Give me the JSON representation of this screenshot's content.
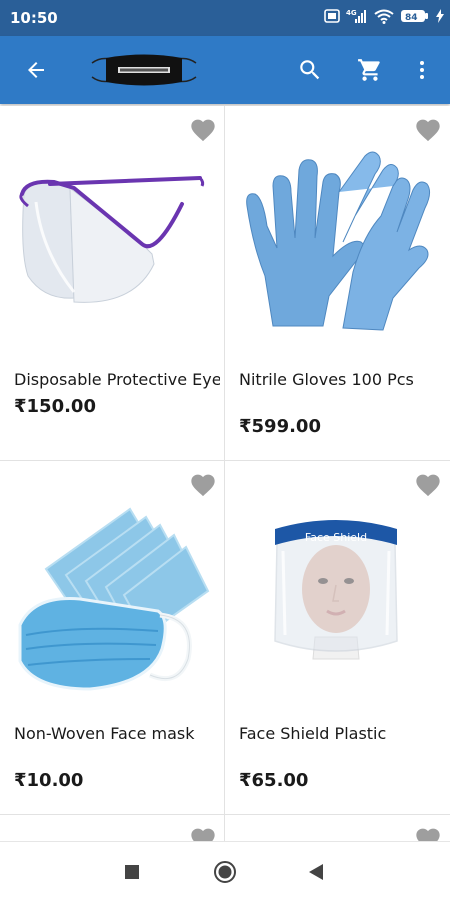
{
  "status_bar": {
    "time": "10:50",
    "network": "4G",
    "battery": "84"
  },
  "app_bar": {
    "back_icon": "arrow-left-icon",
    "logo": "face-mask-logo",
    "search_icon": "search-icon",
    "cart_icon": "cart-icon",
    "menu_icon": "more-vert-icon"
  },
  "products": [
    {
      "name": "Disposable Protective Eye",
      "price": "₹150.00",
      "favorite": false,
      "image": "eye-shield-image"
    },
    {
      "name": "Nitrile Gloves 100 Pcs",
      "price": "₹599.00",
      "favorite": false,
      "image": "nitrile-gloves-image"
    },
    {
      "name": "Non-Woven Face mask",
      "price": "₹10.00",
      "favorite": false,
      "image": "face-mask-image"
    },
    {
      "name": "Face Shield Plastic",
      "price": "₹65.00",
      "favorite": false,
      "image": "face-shield-image",
      "image_label": "Face Shield"
    }
  ],
  "nav_bar": {
    "recent_icon": "square-icon",
    "home_icon": "circle-icon",
    "back_icon": "triangle-back-icon"
  },
  "colors": {
    "status_bar": "#2a5f98",
    "app_bar": "#2f7ac6",
    "heart": "#9e9e9e"
  }
}
